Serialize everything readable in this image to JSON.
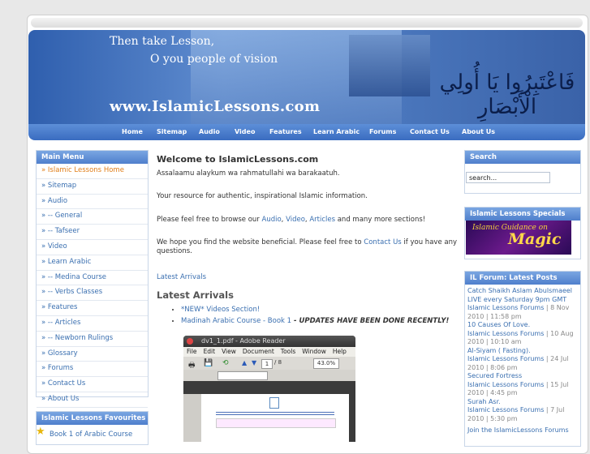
{
  "banner": {
    "tagline1": "Then take Lesson,",
    "tagline2": "O you people of vision",
    "url": "www.IslamicLessons.com",
    "arabic": "فَاعْتَبِرُوا يَا أُولِي الْأَبْصَارِ"
  },
  "nav": [
    "Home",
    "Sitemap",
    "Audio",
    "Video",
    "Features",
    "Learn Arabic",
    "Forums",
    "Contact Us",
    "About Us"
  ],
  "main_menu": {
    "title": "Main Menu",
    "items": [
      "» Islamic Lessons Home",
      "» Sitemap",
      "» Audio",
      "» -- General",
      "» -- Tafseer",
      "» Video",
      "» Learn Arabic",
      "» -- Medina Course",
      "» -- Verbs Classes",
      "» Features",
      "» -- Articles",
      "» -- Newborn Rulings",
      "» Glossary",
      "» Forums",
      "» Contact Us",
      "» About Us"
    ]
  },
  "favourites": {
    "title": "Islamic Lessons Favourites",
    "item": "Book 1 of Arabic Course"
  },
  "content": {
    "heading": "Welcome to IslamicLessons.com",
    "greeting": "Assalaamu alaykum wa rahmatullahi wa barakaatuh.",
    "resource": "Your resource for authentic, inspirational Islamic information.",
    "browse_pre": "Please feel free to browse our ",
    "browse_audio": "Audio",
    "browse_sep1": ", ",
    "browse_video": "Video",
    "browse_sep2": ", ",
    "browse_articles": "Articles",
    "browse_post": " and many more sections!",
    "hope_pre": "We hope you find the website beneficial.  Please feel free to ",
    "hope_link": "Contact Us",
    "hope_post": " if you have any questions.",
    "latest_link": "Latest Arrivals",
    "latest_heading": "Latest Arrivals",
    "list": [
      {
        "link": "*NEW* Videos Section!",
        "note": ""
      },
      {
        "link": "Madinah Arabic Course - Book 1",
        "note": " - UPDATES HAVE BEEN DONE RECENTLY!"
      }
    ]
  },
  "reader": {
    "title": "dv1_1.pdf - Adobe Reader",
    "menus": [
      "File",
      "Edit",
      "View",
      "Document",
      "Tools",
      "Window",
      "Help"
    ],
    "page_field": "1",
    "page_total": "/ 8",
    "zoom": "43.0%"
  },
  "search": {
    "title": "Search",
    "placeholder": "search..."
  },
  "specials": {
    "title": "Islamic Lessons Specials",
    "img_text1": "Islamic Guidance on",
    "img_text2": "Magic"
  },
  "forum": {
    "title": "IL Forum: Latest Posts",
    "posts": [
      {
        "title": "Catch Shaikh Aslam Abulsmaeel LIVE every Saturday 9pm GMT",
        "forum": "Islamic Lessons Forums",
        "date": " | 8 Nov 2010 | 11:58 pm"
      },
      {
        "title": "10 Causes Of Love.",
        "forum": "Islamic Lessons Forums",
        "date": " | 10 Aug 2010 | 10:10 am"
      },
      {
        "title": "Al-Siyam ( Fasting).",
        "forum": "Islamic Lessons Forums",
        "date": " | 24 Jul 2010 | 8:06 pm"
      },
      {
        "title": "Secured Fortress",
        "forum": "Islamic Lessons Forums",
        "date": " | 15 Jul 2010 | 4:45 pm"
      },
      {
        "title": "Surah Asr.",
        "forum": "Islamic Lessons Forums",
        "date": " | 7 Jul 2010 | 5:30 pm"
      }
    ],
    "join": "Join the IslamicLessons Forums"
  }
}
